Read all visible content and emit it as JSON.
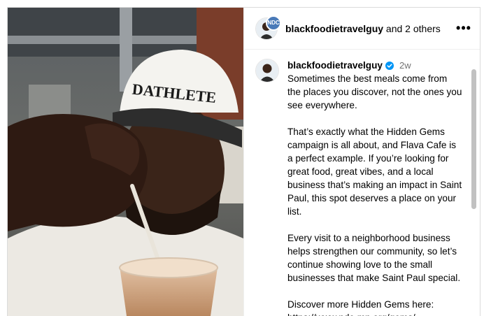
{
  "photo": {
    "hat_text": "DATHLETE"
  },
  "header": {
    "username": "blackfoodietravelguy",
    "others_text": " and 2 others",
    "collab_badge": "NDC",
    "more_icon": "more-horizontal-icon"
  },
  "post": {
    "username": "blackfoodietravelguy",
    "time": "2w",
    "paragraphs": [
      "Sometimes the best meals come from the places you discover, not the ones you see everywhere.",
      "That’s exactly what the Hidden Gems campaign is all about, and Flava Cafe is a perfect example. If you’re looking for great food, great vibes, and a local business that’s making an impact in Saint Paul, this spot deserves a place on your list.",
      "Every visit to a neighborhood business helps strengthen our community, so let’s continue showing love to the small businesses that make Saint Paul special.",
      "Discover more Hidden Gems here:\nhttps://www.ndc-mn.org/gems/"
    ]
  },
  "colors": {
    "verified": "#0095f6",
    "muted": "#737373",
    "border": "#dbdbdb"
  }
}
